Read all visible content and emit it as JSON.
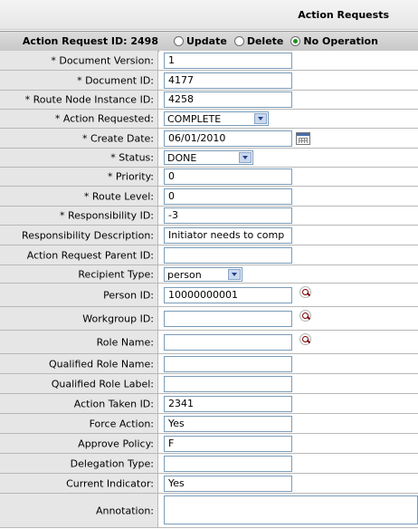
{
  "header": {
    "title": "Action Requests"
  },
  "id_row": {
    "label": "Action Request ID: 2498",
    "options": [
      {
        "label": "Update",
        "checked": false
      },
      {
        "label": "Delete",
        "checked": false
      },
      {
        "label": "No Operation",
        "checked": true
      }
    ]
  },
  "fields": {
    "document_version": {
      "label": "* Document Version:",
      "value": "1"
    },
    "document_id": {
      "label": "* Document ID:",
      "value": "4177"
    },
    "route_node_instance_id": {
      "label": "* Route Node Instance ID:",
      "value": "4258"
    },
    "action_requested": {
      "label": "* Action Requested:",
      "value": "COMPLETE"
    },
    "create_date": {
      "label": "* Create Date:",
      "value": "06/01/2010"
    },
    "status": {
      "label": "* Status:",
      "value": "DONE"
    },
    "priority": {
      "label": "* Priority:",
      "value": "0"
    },
    "route_level": {
      "label": "* Route Level:",
      "value": "0"
    },
    "responsibility_id": {
      "label": "* Responsibility ID:",
      "value": "-3"
    },
    "responsibility_description": {
      "label": "Responsibility Description:",
      "value": "Initiator needs to comp"
    },
    "action_request_parent_id": {
      "label": "Action Request Parent ID:",
      "value": ""
    },
    "recipient_type": {
      "label": "Recipient Type:",
      "value": "person"
    },
    "person_id": {
      "label": "Person ID:",
      "value": "10000000001"
    },
    "workgroup_id": {
      "label": "Workgroup ID:",
      "value": ""
    },
    "role_name": {
      "label": "Role Name:",
      "value": ""
    },
    "qualified_role_name": {
      "label": "Qualified Role Name:",
      "value": ""
    },
    "qualified_role_label": {
      "label": "Qualified Role Label:",
      "value": ""
    },
    "action_taken_id": {
      "label": "Action Taken ID:",
      "value": "2341"
    },
    "force_action": {
      "label": "Force Action:",
      "value": "Yes"
    },
    "approve_policy": {
      "label": "Approve Policy:",
      "value": "F"
    },
    "delegation_type": {
      "label": "Delegation Type:",
      "value": ""
    },
    "current_indicator": {
      "label": "Current Indicator:",
      "value": "Yes"
    },
    "annotation": {
      "label": "Annotation:",
      "value": ""
    }
  }
}
